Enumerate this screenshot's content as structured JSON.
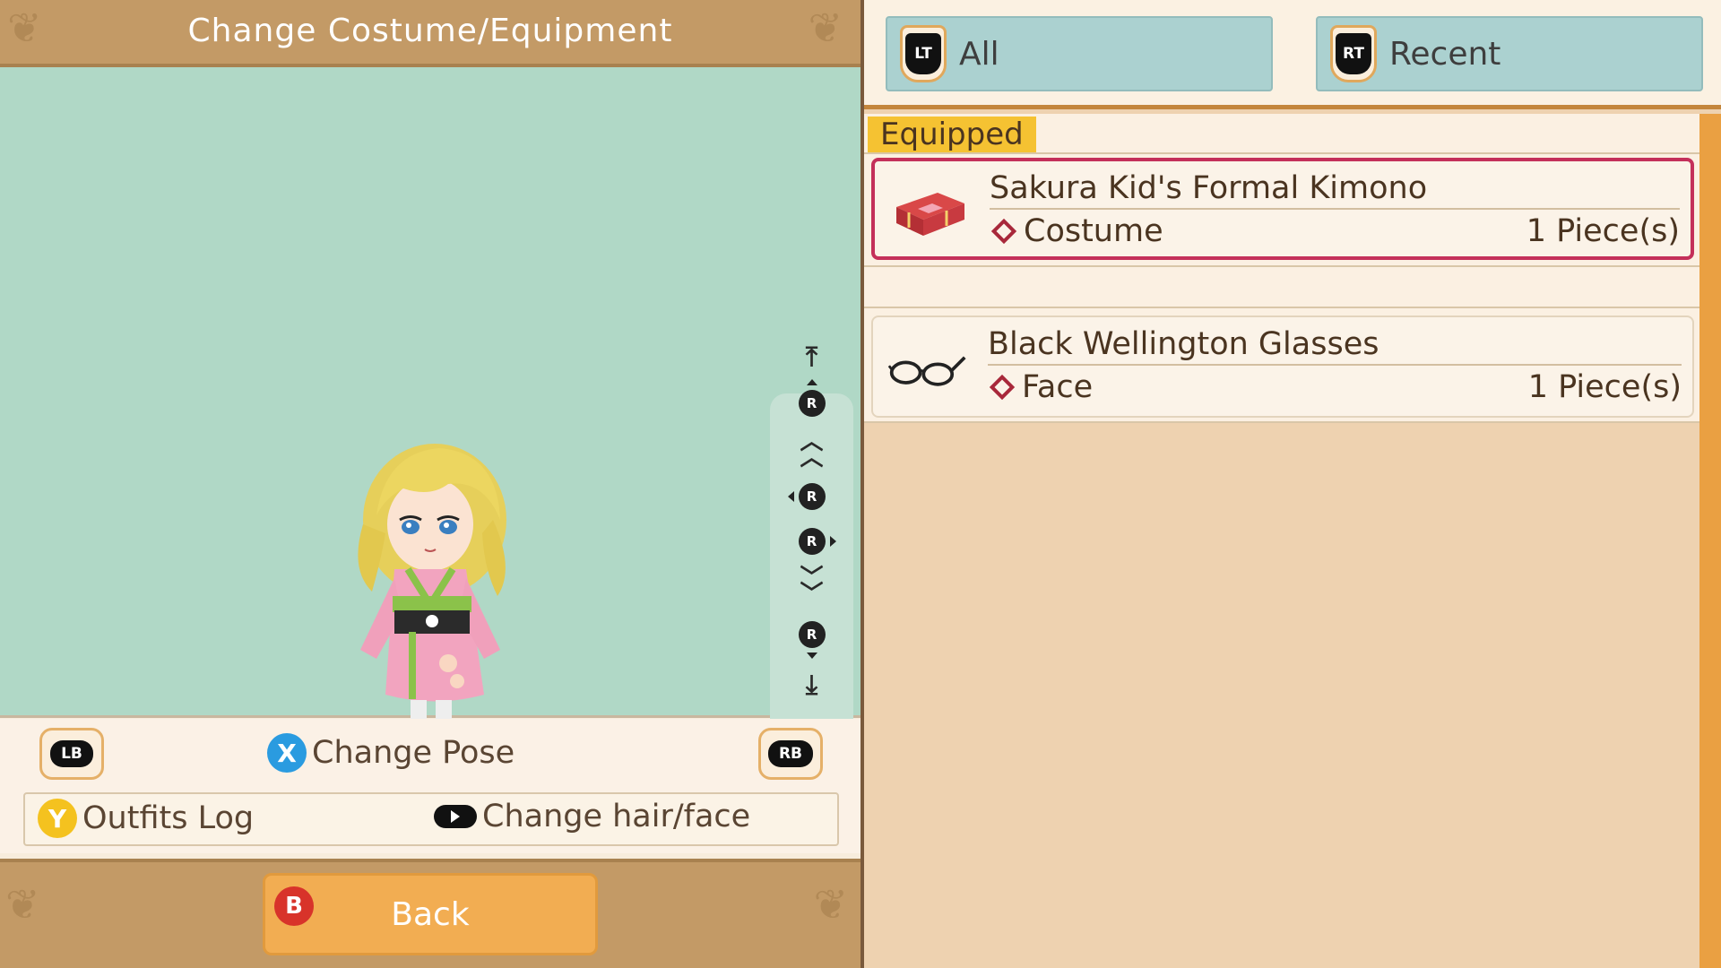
{
  "header": {
    "title": "Change Costume/Equipment"
  },
  "controls": {
    "lb_label": "LB",
    "rb_label": "RB",
    "pose_button": "X",
    "pose_label": "Change Pose",
    "outfits_button": "Y",
    "outfits_label": "Outfits Log",
    "hairface_label": "Change hair/face",
    "back_button": "B",
    "back_label": "Back"
  },
  "camera": {
    "stick_label": "R"
  },
  "tabs": [
    {
      "trigger": "LT",
      "label": "All"
    },
    {
      "trigger": "RT",
      "label": "Recent"
    }
  ],
  "list": {
    "section_label": "Equipped",
    "items": [
      {
        "name": "Sakura Kid's Formal Kimono",
        "type": "Costume",
        "count": "1 Piece(s)",
        "icon": "kimono-box-icon"
      },
      {
        "name": "Black Wellington Glasses",
        "type": "Face",
        "count": "1 Piece(s)",
        "icon": "glasses-icon"
      }
    ]
  },
  "colors": {
    "gold_bar": "#c39a66",
    "viewport": "#b0d8c6",
    "tab": "#abd1d0",
    "selected_border": "#c4305a",
    "equipped_tag": "#f5c232",
    "back_button": "#f2ad52",
    "scrollbar": "#eaa042"
  }
}
